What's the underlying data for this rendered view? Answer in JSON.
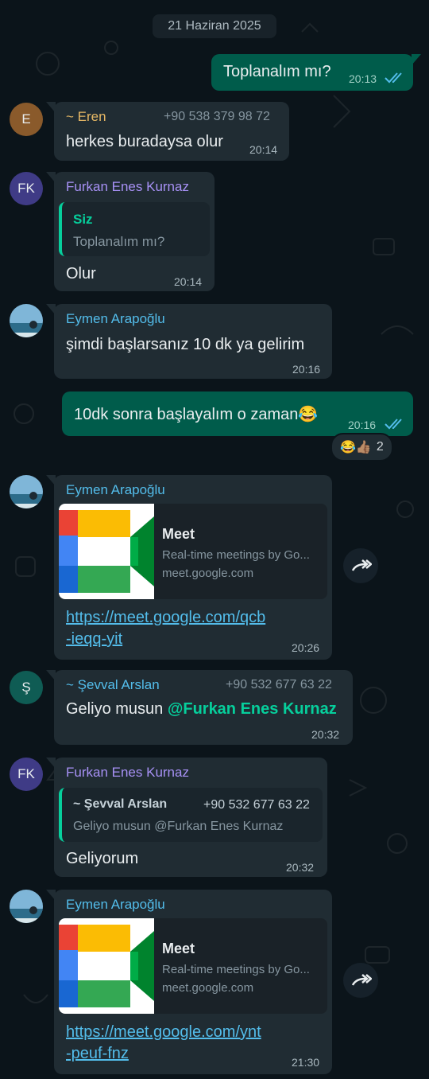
{
  "date_chip": "21 Haziran 2025",
  "colors": {
    "background": "#0b141a",
    "incoming_bubble": "#202c33",
    "outgoing_bubble": "#005c4b",
    "link": "#53bdeb",
    "mention": "#06cf9c",
    "read_ticks": "#53bdeb"
  },
  "messages": [
    {
      "type": "outgoing",
      "text": "Toplanalım mı?",
      "time": "20:13",
      "status": "read-ticks-icon"
    },
    {
      "type": "incoming",
      "avatar_letter": "E",
      "sender": "~ Eren",
      "phone": "+90 538 379 98 72",
      "text": "herkes buradaysa olur",
      "time": "20:14"
    },
    {
      "type": "incoming",
      "avatar_letter": "FK",
      "sender": "Furkan Enes Kurnaz",
      "quote_sender": "Siz",
      "quote_text": "Toplanalım mı?",
      "text": "Olur",
      "time": "20:14"
    },
    {
      "type": "incoming",
      "avatar": "profile-photo",
      "sender": "Eymen Arapoğlu",
      "text": "şimdi başlarsanız 10 dk ya gelirim",
      "time": "20:16"
    },
    {
      "type": "outgoing",
      "text": "10dk sonra başlayalım o zaman😂",
      "time": "20:16",
      "status": "read-ticks-icon",
      "reactions": {
        "emojis": "😂👍🏽",
        "count": "2"
      }
    },
    {
      "type": "incoming",
      "avatar": "profile-photo",
      "sender": "Eymen Arapoğlu",
      "preview_title": "Meet",
      "preview_desc": "Real-time meetings by Go...",
      "preview_domain": "meet.google.com",
      "link_line1": "https://meet.google.com/qcb",
      "link_line2": "-ieqq-yit",
      "time": "20:26"
    },
    {
      "type": "incoming",
      "avatar_letter": "Ş",
      "sender": "~ Şevval Arslan",
      "phone": "+90 532 677 63 22",
      "text_prefix": "Geliyo musun ",
      "mention": "@Furkan Enes Kurnaz",
      "time": "20:32"
    },
    {
      "type": "incoming",
      "avatar_letter": "FK",
      "sender": "Furkan Enes Kurnaz",
      "quote_sender": "~ Şevval Arslan",
      "quote_phone": "+90 532 677 63 22",
      "quote_text": "Geliyo musun @Furkan Enes Kurnaz",
      "text": "Geliyorum",
      "time": "20:32"
    },
    {
      "type": "incoming",
      "avatar": "profile-photo",
      "sender": "Eymen Arapoğlu",
      "preview_title": "Meet",
      "preview_desc": "Real-time meetings by Go...",
      "preview_domain": "meet.google.com",
      "link_line1": "https://meet.google.com/ynt",
      "link_line2": "-peuf-fnz",
      "time": "21:30"
    }
  ]
}
